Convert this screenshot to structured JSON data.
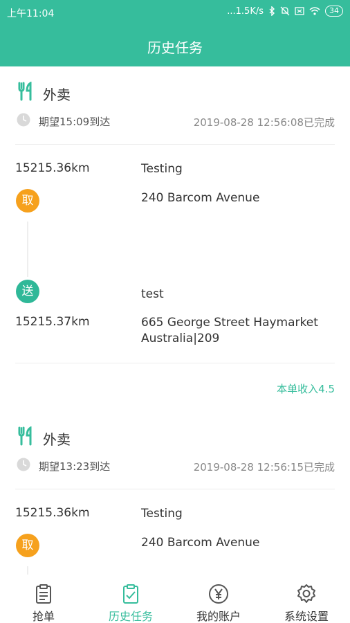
{
  "status_bar": {
    "time": "上午11:04",
    "network_speed": "...1.5K/s",
    "battery": "34"
  },
  "header": {
    "title": "历史任务"
  },
  "orders": [
    {
      "type": "外卖",
      "eta": "期望15:09到达",
      "completed_at": "2019-08-28 12:56:08已完成",
      "pickup": {
        "badge": "取",
        "distance": "15215.36km",
        "name": "Testing",
        "address": "240 Barcom Avenue"
      },
      "dropoff": {
        "badge": "送",
        "distance": "15215.37km",
        "name": "test",
        "address_line1": "665 George Street Haymarket",
        "address_line2": "Australia|209"
      },
      "income": "本单收入4.5"
    },
    {
      "type": "外卖",
      "eta": "期望13:23到达",
      "completed_at": "2019-08-28 12:56:15已完成",
      "pickup": {
        "badge": "取",
        "distance": "15215.36km",
        "name": "Testing",
        "address": "240 Barcom Avenue"
      }
    }
  ],
  "tabbar": {
    "items": [
      {
        "label": "抢单",
        "icon": "clipboard-icon"
      },
      {
        "label": "历史任务",
        "icon": "clipboard-check-icon"
      },
      {
        "label": "我的账户",
        "icon": "yen-coin-icon"
      },
      {
        "label": "系统设置",
        "icon": "gear-icon"
      }
    ],
    "active_index": 1
  },
  "colors": {
    "brand": "#36bd9c",
    "pickup": "#f6a11d",
    "dropoff": "#2fb898"
  }
}
